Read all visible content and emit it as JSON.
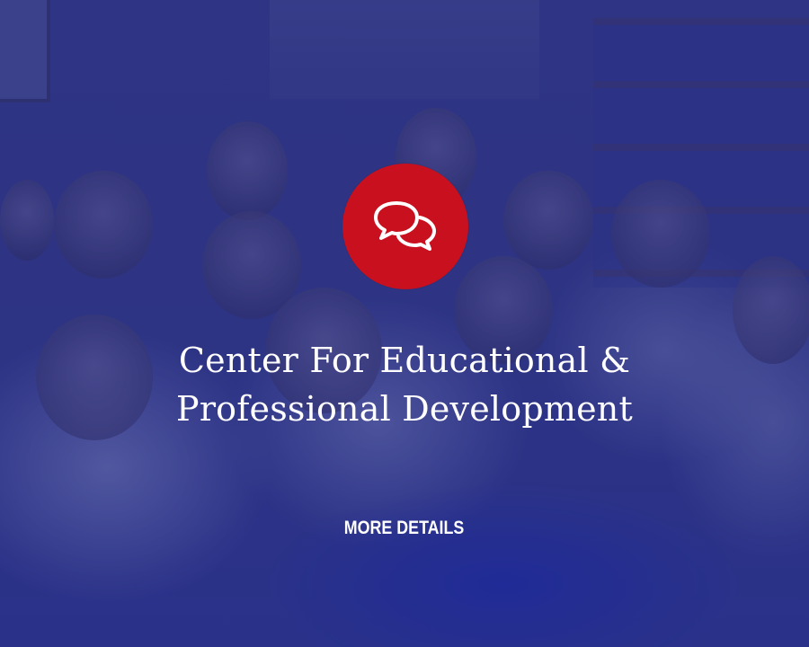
{
  "card": {
    "title_line_1": "Center For Educational &",
    "title_line_2": "Professional Development",
    "link_label": "MORE DETAILS",
    "icon": "chat-bubbles-icon",
    "icon_bg_color": "#c8101e",
    "overlay_color": "#20268a"
  }
}
